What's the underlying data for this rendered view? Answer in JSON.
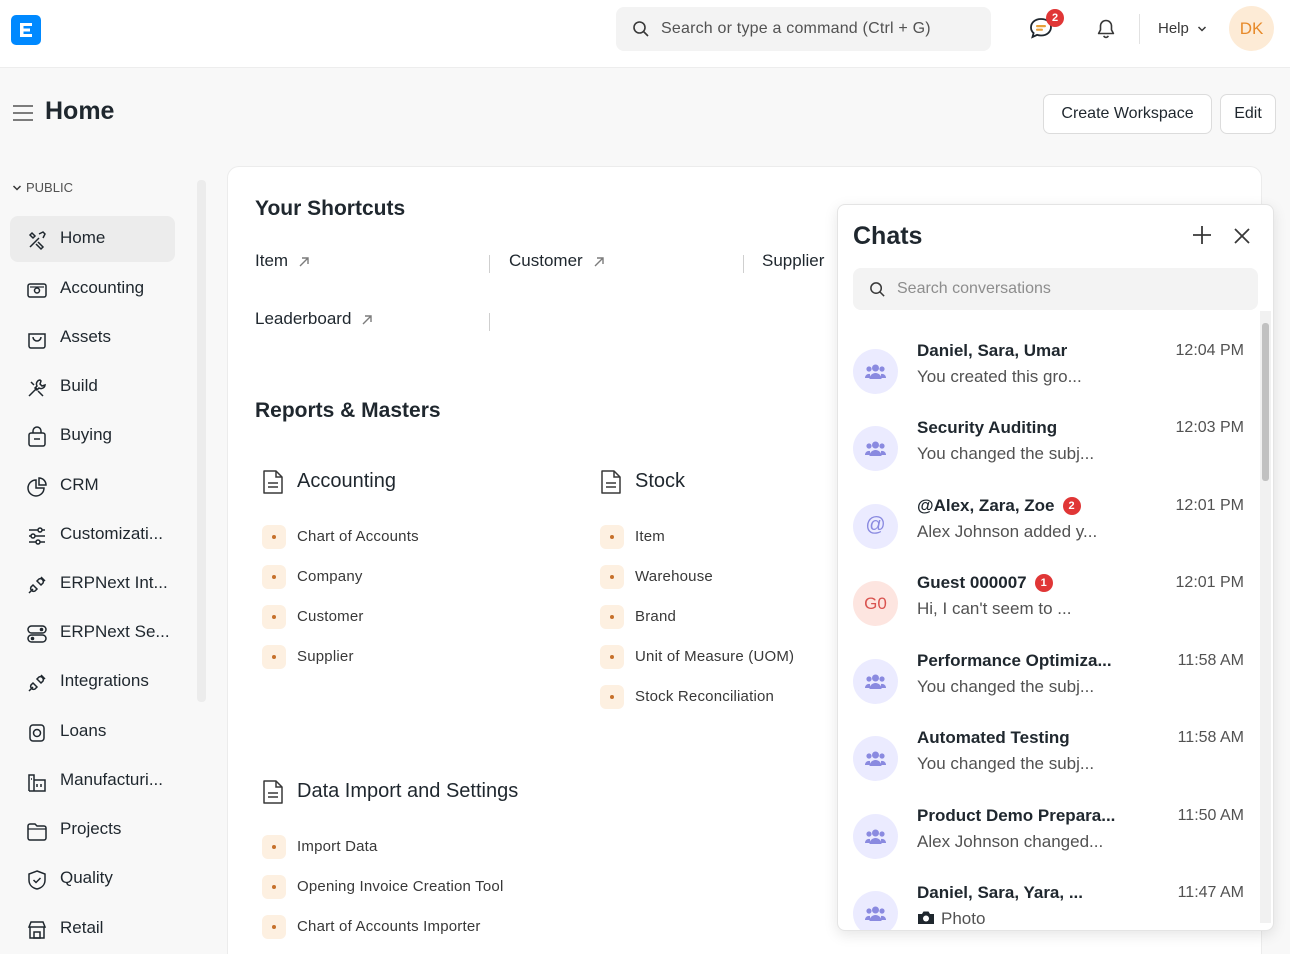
{
  "navbar": {
    "search_placeholder": "Search or type a command (Ctrl + G)",
    "chat_badge": "2",
    "help_label": "Help",
    "avatar_initials": "DK"
  },
  "page": {
    "title": "Home",
    "create_workspace_label": "Create Workspace",
    "edit_label": "Edit"
  },
  "sidebar": {
    "section_label": "PUBLIC",
    "items": [
      {
        "label": "Home",
        "icon": "tools-icon",
        "active": true
      },
      {
        "label": "Accounting",
        "icon": "money-icon"
      },
      {
        "label": "Assets",
        "icon": "box-icon"
      },
      {
        "label": "Build",
        "icon": "wrench-icon"
      },
      {
        "label": "Buying",
        "icon": "bag-icon"
      },
      {
        "label": "CRM",
        "icon": "pie-icon"
      },
      {
        "label": "Customizati...",
        "icon": "sliders-icon"
      },
      {
        "label": "ERPNext Int...",
        "icon": "plug-icon"
      },
      {
        "label": "ERPNext Se...",
        "icon": "toggle-icon"
      },
      {
        "label": "Integrations",
        "icon": "plug-icon"
      },
      {
        "label": "Loans",
        "icon": "loan-icon"
      },
      {
        "label": "Manufacturi...",
        "icon": "factory-icon"
      },
      {
        "label": "Projects",
        "icon": "folder-icon"
      },
      {
        "label": "Quality",
        "icon": "shield-icon"
      },
      {
        "label": "Retail",
        "icon": "store-icon"
      }
    ]
  },
  "shortcuts": {
    "title": "Your Shortcuts",
    "items": [
      "Item",
      "Customer",
      "Supplier",
      "Leaderboard"
    ]
  },
  "reports": {
    "title": "Reports & Masters",
    "accounting": {
      "title": "Accounting",
      "links": [
        "Chart of Accounts",
        "Company",
        "Customer",
        "Supplier"
      ]
    },
    "stock": {
      "title": "Stock",
      "links": [
        "Item",
        "Warehouse",
        "Brand",
        "Unit of Measure (UOM)",
        "Stock Reconciliation"
      ]
    },
    "data_import": {
      "title": "Data Import and Settings",
      "links": [
        "Import Data",
        "Opening Invoice Creation Tool",
        "Chart of Accounts Importer"
      ]
    }
  },
  "chats": {
    "title": "Chats",
    "search_placeholder": "Search conversations",
    "conversations": [
      {
        "name": "Daniel, Sara, Umar",
        "message": "You created this gro...",
        "time": "12:04 PM",
        "avatar": "group-icon"
      },
      {
        "name": "Security Auditing",
        "message": "You changed the subj...",
        "time": "12:03 PM",
        "avatar": "group-icon"
      },
      {
        "name": "@Alex, Zara, Zoe",
        "badge": "2",
        "message": "Alex Johnson added y...",
        "time": "12:01 PM",
        "avatar": "@"
      },
      {
        "name": "Guest 000007",
        "badge": "1",
        "message": "Hi, I can't seem to ...",
        "time": "12:01 PM",
        "avatar": "G0"
      },
      {
        "name": "Performance Optimiza...",
        "message": "You changed the subj...",
        "time": "11:58 AM",
        "avatar": "group-icon"
      },
      {
        "name": "Automated Testing",
        "message": "You changed the subj...",
        "time": "11:58 AM",
        "avatar": "group-icon"
      },
      {
        "name": "Product Demo Prepara...",
        "message": "Alex Johnson changed...",
        "time": "11:50 AM",
        "avatar": "group-icon"
      },
      {
        "name": "Daniel, Sara, Yara, ...",
        "message": "Photo",
        "time": "11:47 AM",
        "avatar": "group-icon"
      }
    ]
  },
  "colors": {
    "accent": "#0089ff",
    "badge": "#e03636",
    "avatar_bg": "#fdebd6",
    "link_dot": "#c6702a"
  }
}
